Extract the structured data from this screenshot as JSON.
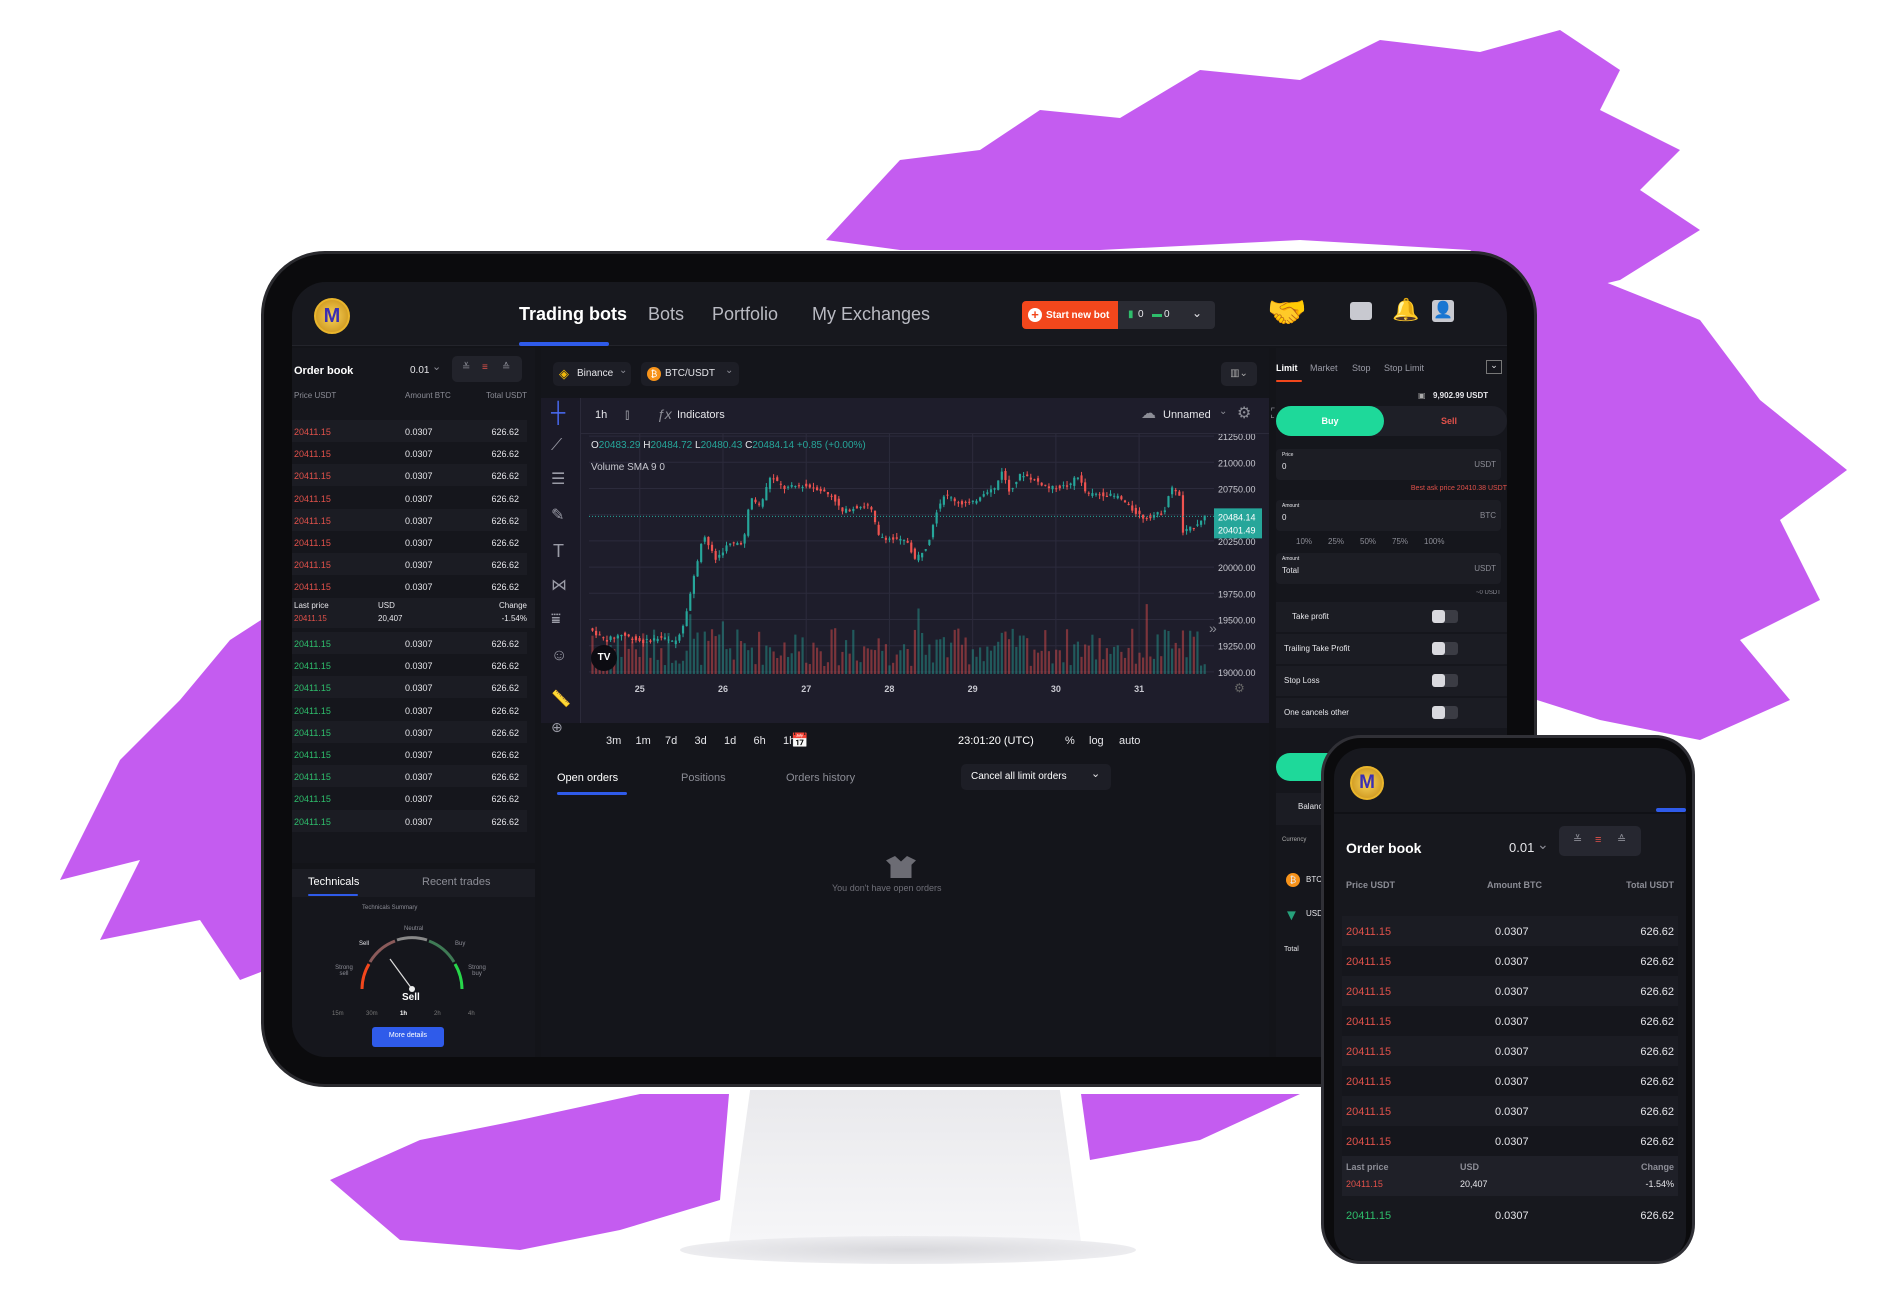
{
  "colors": {
    "accent": "#2f5bea",
    "brand_orange": "#f2471c",
    "buy": "#1ed99a",
    "sell": "#e0514a",
    "bull": "#26a69a",
    "bear": "#ef5350",
    "splash": "#c45cf0"
  },
  "header": {
    "logo_icon": "m-coin-logo",
    "nav": [
      {
        "label": "Trading bots",
        "active": true
      },
      {
        "label": "Bots"
      },
      {
        "label": "Portfolio"
      },
      {
        "label": "My Exchanges"
      }
    ],
    "start_bot_label": "Start new bot",
    "running_count": "0",
    "stopped_count": "0",
    "icons": [
      "handshake-icon",
      "wallet-icon",
      "bell-icon",
      "user-icon"
    ]
  },
  "orderbook": {
    "title": "Order book",
    "step": "0.01",
    "columns": [
      "Price USDT",
      "Amount BTC",
      "Total USDT"
    ],
    "asks": [
      [
        "20411.15",
        "0.0307",
        "626.62"
      ],
      [
        "20411.15",
        "0.0307",
        "626.62"
      ],
      [
        "20411.15",
        "0.0307",
        "626.62"
      ],
      [
        "20411.15",
        "0.0307",
        "626.62"
      ],
      [
        "20411.15",
        "0.0307",
        "626.62"
      ],
      [
        "20411.15",
        "0.0307",
        "626.62"
      ],
      [
        "20411.15",
        "0.0307",
        "626.62"
      ],
      [
        "20411.15",
        "0.0307",
        "626.62"
      ]
    ],
    "last": {
      "label": "Last price",
      "usd_label": "USD",
      "change_label": "Change",
      "price": "20411.15",
      "usd": "20,407",
      "change": "-1.54%"
    },
    "bids": [
      [
        "20411.15",
        "0.0307",
        "626.62"
      ],
      [
        "20411.15",
        "0.0307",
        "626.62"
      ],
      [
        "20411.15",
        "0.0307",
        "626.62"
      ],
      [
        "20411.15",
        "0.0307",
        "626.62"
      ],
      [
        "20411.15",
        "0.0307",
        "626.62"
      ],
      [
        "20411.15",
        "0.0307",
        "626.62"
      ],
      [
        "20411.15",
        "0.0307",
        "626.62"
      ],
      [
        "20411.15",
        "0.0307",
        "626.62"
      ],
      [
        "20411.15",
        "0.0307",
        "626.62"
      ]
    ]
  },
  "technicals": {
    "tabs": [
      "Technicals",
      "Recent trades"
    ],
    "summary": "Technicals Summary",
    "labels": {
      "neutral": "Neutral",
      "sell": "Sell",
      "buy": "Buy",
      "strong_sell": "Strong sell",
      "strong_buy": "Strong buy"
    },
    "result": "Sell",
    "timeframes": [
      "15m",
      "30m",
      "1h",
      "2h",
      "4h"
    ],
    "active_timeframe": "1h",
    "more": "More details"
  },
  "chart_header": {
    "exchange": "Binance",
    "pair": "BTC/USDT"
  },
  "chart_toolbar": {
    "interval": "1h",
    "indicators": "Indicators",
    "layout_name": "Unnamed"
  },
  "ohlc": {
    "o_label": "O",
    "o": "20483.29",
    "h_label": "H",
    "h": "20484.72",
    "l_label": "L",
    "l": "20480.43",
    "c_label": "C",
    "c": "20484.14",
    "change": "+0.85 (+0.00%)",
    "volume": "Volume SMA 9",
    "volume_val": "0"
  },
  "chart_data": {
    "type": "candlestick",
    "x_ticks": [
      "25",
      "26",
      "27",
      "28",
      "29",
      "30",
      "31"
    ],
    "xlim": [
      24.39,
      31.9
    ],
    "y_ticks": [
      "21250.00",
      "21000.00",
      "20750.00",
      "20500.00",
      "20250.00",
      "20000.00",
      "19750.00",
      "19500.00",
      "19250.00",
      "19000.00"
    ],
    "ylim": [
      18980,
      21270
    ],
    "last_price": "20484.14",
    "prev_price": "20401.49",
    "grid": true,
    "price_path": [
      [
        24.41,
        19416
      ],
      [
        24.61,
        19302
      ],
      [
        24.8,
        19359
      ],
      [
        25.05,
        19288
      ],
      [
        25.29,
        19330
      ],
      [
        25.44,
        19273
      ],
      [
        25.54,
        19444
      ],
      [
        25.64,
        19785
      ],
      [
        25.74,
        20155
      ],
      [
        25.78,
        20326
      ],
      [
        25.93,
        20070
      ],
      [
        26.08,
        20212
      ],
      [
        26.27,
        20240
      ],
      [
        26.35,
        20667
      ],
      [
        26.47,
        20582
      ],
      [
        26.59,
        20866
      ],
      [
        26.76,
        20752
      ],
      [
        26.96,
        20781
      ],
      [
        27.16,
        20752
      ],
      [
        27.35,
        20667
      ],
      [
        27.45,
        20525
      ],
      [
        27.65,
        20582
      ],
      [
        27.79,
        20582
      ],
      [
        27.89,
        20297
      ],
      [
        28.04,
        20269
      ],
      [
        28.24,
        20240
      ],
      [
        28.33,
        20070
      ],
      [
        28.48,
        20212
      ],
      [
        28.58,
        20525
      ],
      [
        28.68,
        20695
      ],
      [
        28.87,
        20610
      ],
      [
        29.02,
        20610
      ],
      [
        29.17,
        20724
      ],
      [
        29.31,
        20752
      ],
      [
        29.36,
        20951
      ],
      [
        29.46,
        20724
      ],
      [
        29.61,
        20894
      ],
      [
        29.75,
        20838
      ],
      [
        29.95,
        20752
      ],
      [
        30.2,
        20781
      ],
      [
        30.27,
        20894
      ],
      [
        30.39,
        20695
      ],
      [
        30.59,
        20695
      ],
      [
        30.78,
        20667
      ],
      [
        30.93,
        20553
      ],
      [
        31.08,
        20468
      ],
      [
        31.32,
        20525
      ],
      [
        31.4,
        20752
      ],
      [
        31.5,
        20724
      ],
      [
        31.54,
        20326
      ],
      [
        31.67,
        20382
      ],
      [
        31.81,
        20484
      ]
    ]
  },
  "timebar": {
    "ranges": [
      "3m",
      "1m",
      "7d",
      "3d",
      "1d",
      "6h",
      "1h"
    ],
    "clock": "23:01:20 (UTC)",
    "percent": "%",
    "log": "log",
    "auto": "auto"
  },
  "orders": {
    "tabs": [
      "Open orders",
      "Positions",
      "Orders history"
    ],
    "cancel": "Cancel all limit orders",
    "empty": "You don't have open orders"
  },
  "trade": {
    "tabs": [
      "Limit",
      "Market",
      "Stop",
      "Stop Limit"
    ],
    "balance": "9,902.99 USDT",
    "buy": "Buy",
    "sell": "Sell",
    "price_label": "Price",
    "price": "0",
    "price_unit": "USDT",
    "best_ask": "Best ask price 20410.38 USDT",
    "amount_label": "Amount",
    "amount": "0",
    "amount_unit": "BTC",
    "percents": [
      "10%",
      "25%",
      "50%",
      "75%",
      "100%"
    ],
    "total_label": "Amount",
    "total": "Total",
    "total_unit": "USDT",
    "approx": "~0 USDT",
    "toggles": [
      {
        "label": "Take profit",
        "on": false
      },
      {
        "label": "Trailing Take Profit",
        "on": false
      },
      {
        "label": "Stop Loss",
        "on": false
      },
      {
        "label": "One cancels other",
        "on": false
      }
    ],
    "balances": "Balances",
    "currency": "Currency",
    "coins": [
      "BTC",
      "USDT"
    ]
  },
  "phone": {
    "title": "Order book",
    "step": "0.01",
    "columns": [
      "Price USDT",
      "Amount BTC",
      "Total USDT"
    ],
    "asks": [
      [
        "20411.15",
        "0.0307",
        "626.62"
      ],
      [
        "20411.15",
        "0.0307",
        "626.62"
      ],
      [
        "20411.15",
        "0.0307",
        "626.62"
      ],
      [
        "20411.15",
        "0.0307",
        "626.62"
      ],
      [
        "20411.15",
        "0.0307",
        "626.62"
      ],
      [
        "20411.15",
        "0.0307",
        "626.62"
      ],
      [
        "20411.15",
        "0.0307",
        "626.62"
      ],
      [
        "20411.15",
        "0.0307",
        "626.62"
      ]
    ],
    "last": {
      "label": "Last price",
      "usd_label": "USD",
      "change_label": "Change",
      "price": "20411.15",
      "usd": "20,407",
      "change": "-1.54%"
    },
    "bid": [
      "20411.15",
      "0.0307",
      "626.62"
    ]
  }
}
